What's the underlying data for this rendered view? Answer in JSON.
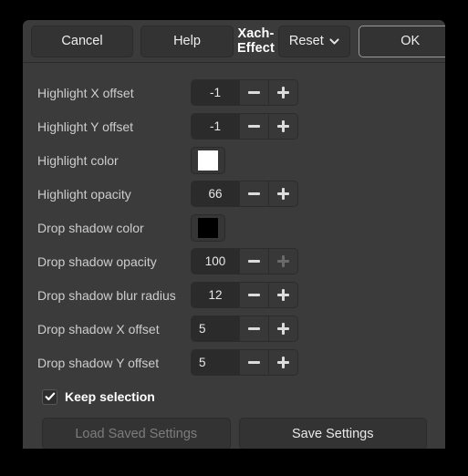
{
  "dialog": {
    "title": "Xach-Effect",
    "header_buttons": {
      "cancel": "Cancel",
      "help": "Help",
      "reset": "Reset",
      "ok": "OK"
    },
    "icons": {
      "chevron_down": "chevron-down-icon",
      "check": "check-icon",
      "minus": "minus-icon",
      "plus": "plus-icon"
    }
  },
  "rows": [
    {
      "label": "Highlight X offset",
      "type": "spinner",
      "value": "-1",
      "align": "center",
      "plus_enabled": true,
      "minus_enabled": true
    },
    {
      "label": "Highlight Y offset",
      "type": "spinner",
      "value": "-1",
      "align": "center",
      "plus_enabled": true,
      "minus_enabled": true
    },
    {
      "label": "Highlight color",
      "type": "color",
      "value": "#ffffff"
    },
    {
      "label": "Highlight opacity",
      "type": "spinner",
      "value": "66",
      "align": "center",
      "plus_enabled": true,
      "minus_enabled": true
    },
    {
      "label": "Drop shadow color",
      "type": "color",
      "value": "#000000"
    },
    {
      "label": "Drop shadow opacity",
      "type": "spinner",
      "value": "100",
      "align": "center",
      "plus_enabled": false,
      "minus_enabled": true
    },
    {
      "label": "Drop shadow blur radius",
      "type": "spinner",
      "value": "12",
      "align": "center",
      "plus_enabled": true,
      "minus_enabled": true
    },
    {
      "label": "Drop shadow X offset",
      "type": "spinner",
      "value": "5",
      "align": "lead",
      "plus_enabled": true,
      "minus_enabled": true
    },
    {
      "label": "Drop shadow Y offset",
      "type": "spinner",
      "value": "5",
      "align": "lead",
      "plus_enabled": true,
      "minus_enabled": true
    }
  ],
  "keep_selection": {
    "label": "Keep selection",
    "checked": true
  },
  "footer": {
    "load": "Load Saved Settings",
    "load_enabled": false,
    "save": "Save Settings",
    "save_enabled": true
  },
  "colors": {
    "dialog_bg": "#3b3b3b",
    "button_bg": "#333333",
    "entry_bg": "#2b2b2b",
    "label_text": "#cdcdcd",
    "disabled_text": "#7d7d7d"
  }
}
